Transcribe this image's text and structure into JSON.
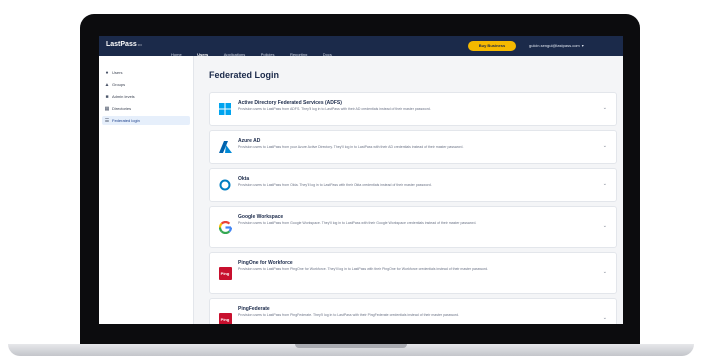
{
  "topnav": {
    "logo": "LastPass",
    "logo_suffix": "•••",
    "links": [
      "Home",
      "Users",
      "Applications",
      "Policies",
      "Reporting",
      "Docs"
    ],
    "active_link": "Users",
    "buy_button": "Buy Business",
    "user_email": "gulcin.sengul@lastpass.com"
  },
  "sidebar": {
    "items": [
      {
        "label": "Users",
        "icon": "user-icon"
      },
      {
        "label": "Groups",
        "icon": "groups-icon"
      },
      {
        "label": "Admin levels",
        "icon": "admin-icon"
      },
      {
        "label": "Directories",
        "icon": "directory-icon"
      },
      {
        "label": "Federated login",
        "icon": "federated-icon"
      }
    ],
    "active_index": 4
  },
  "main": {
    "title": "Federated Login",
    "providers": [
      {
        "name": "Active Directory Federated Services (ADFS)",
        "desc": "Provision users to LastPass from ADFS. They'll log in to LastPass with their AD credentials instead of their master password.",
        "icon": "windows-icon"
      },
      {
        "name": "Azure AD",
        "desc": "Provision users to LastPass from your Azure Active Directory. They'll log in to LastPass with their AD credentials instead of their master password.",
        "icon": "azure-icon"
      },
      {
        "name": "Okta",
        "desc": "Provision users to LastPass from Okta. They'll log in to LastPass with their Okta credentials instead of their master password.",
        "icon": "okta-icon"
      },
      {
        "name": "Google Workspace",
        "desc": "Provision users to LastPass from Google Workspace. They'll log in to LastPass with their Google Workspace credentials instead of their master password.",
        "icon": "google-icon"
      },
      {
        "name": "PingOne for Workforce",
        "desc": "Provision users to LastPass from PingOne for Workforce. They'll log in to LastPass with their PingOne for Workforce credentials instead of their master password.",
        "icon": "ping-icon"
      },
      {
        "name": "PingFederate",
        "desc": "Provision users to LastPass from PingFederate. They'll log in to LastPass with their PingFederate credentials instead of their master password.",
        "icon": "ping-icon"
      }
    ]
  },
  "colors": {
    "nav_bg": "#1b2a4a",
    "accent_yellow": "#f5b900",
    "windows_blue": "#00a4ef",
    "azure_blue": "#0062ad",
    "okta_blue": "#007dc1",
    "ping_red": "#c8102e"
  }
}
